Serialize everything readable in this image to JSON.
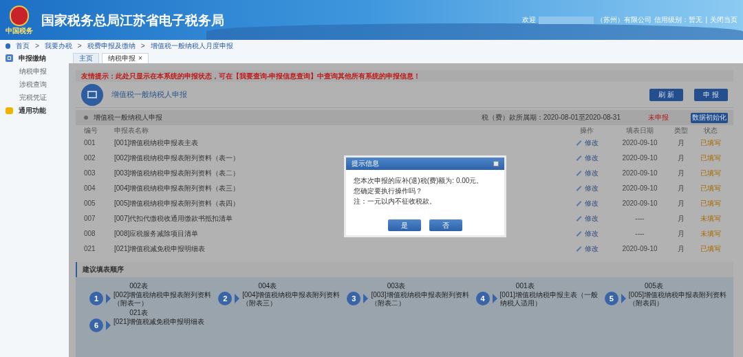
{
  "header": {
    "title": "国家税务总局江苏省电子税务局",
    "logo_text": "中国税务",
    "welcome": "欢迎",
    "company": "（苏州）有限公司",
    "credit": "信用级别：暂无",
    "separator": "|",
    "close": "关闭当页"
  },
  "breadcrumb": [
    "首页",
    "我要办税",
    "税费申报及缴纳",
    "增值税一般纳税人月度申报"
  ],
  "breadcrumb_separator": ">",
  "sidebar": [
    {
      "label": "申报缴纳",
      "children": [
        {
          "label": "纳税申报"
        },
        {
          "label": "涉税查询"
        },
        {
          "label": "完税凭证"
        }
      ]
    },
    {
      "label": "通用功能"
    }
  ],
  "tabs": [
    {
      "label": "主页",
      "selected": false,
      "closable": false
    },
    {
      "label": "纳税申报",
      "selected": true,
      "closable": true
    }
  ],
  "tab_close": "×",
  "notice": "友情提示：此处只显示在本系统的申报状态，可在【我要查询-申报信息查询】中查询其他所有系统的申报信息！",
  "form_title": "增值税一般纳税人申报",
  "buttons": [
    "刷 新",
    "申 报"
  ],
  "section": {
    "label": "增值税一般纳税人申报",
    "period": "税（费）款所属期：2020-08-01至2020-08-31",
    "status": "未申报",
    "init_button": "数据初始化"
  },
  "table": {
    "columns": [
      "编号",
      "申报表名称",
      "操作",
      "填表日期",
      "类型",
      "状态"
    ],
    "rows": [
      {
        "no": "001",
        "name": "[001]增值税纳税申报表主表",
        "action": "修改",
        "date": "2020-09-10",
        "type": "月",
        "status": "已填写"
      },
      {
        "no": "002",
        "name": "[002]增值税纳税申报表附列资料（表一）",
        "action": "修改",
        "date": "2020-09-10",
        "type": "月",
        "status": "已填写"
      },
      {
        "no": "003",
        "name": "[003]增值税纳税申报表附列资料（表二）",
        "action": "修改",
        "date": "2020-09-10",
        "type": "月",
        "status": "已填写"
      },
      {
        "no": "004",
        "name": "[004]增值税纳税申报表附列资料（表三）",
        "action": "修改",
        "date": "2020-09-10",
        "type": "月",
        "status": "已填写"
      },
      {
        "no": "005",
        "name": "[005]增值税纳税申报表附列资料（表四）",
        "action": "修改",
        "date": "2020-09-10",
        "type": "月",
        "status": "已填写"
      },
      {
        "no": "007",
        "name": "[007]代扣代缴税收通用缴款书抵扣清单",
        "action": "修改",
        "date": "----",
        "type": "月",
        "status": "未填写"
      },
      {
        "no": "008",
        "name": "[008]应税服务减除项目清单",
        "action": "修改",
        "date": "----",
        "type": "月",
        "status": "未填写"
      },
      {
        "no": "021",
        "name": "[021]增值税减免税申报明细表",
        "action": "修改",
        "date": "2020-09-10",
        "type": "月",
        "status": "已填写"
      }
    ]
  },
  "order": {
    "title": "建议填表顺序",
    "steps": [
      {
        "number": "1",
        "code": "002表",
        "desc": [
          "[002]增值税纳税申报表附列资料",
          "（附表一）"
        ]
      },
      {
        "number": "2",
        "code": "004表",
        "desc": [
          "[004]增值税纳税申报表附列资料",
          "（附表三）"
        ]
      },
      {
        "number": "3",
        "code": "003表",
        "desc": [
          "[003]增值税纳税申报表附列资料",
          "（附表二）"
        ]
      },
      {
        "number": "4",
        "code": "001表",
        "desc": [
          "[001]增值税纳税申报主表（一般",
          "纳税人适用）"
        ]
      },
      {
        "number": "5",
        "code": "005表",
        "desc": [
          "[005]增值税纳税申报表附列资料",
          "（附表四）"
        ]
      },
      {
        "number": "6",
        "code": "021表",
        "desc": [
          "[021]增值税减免税申报明细表"
        ]
      }
    ]
  },
  "dialog": {
    "title": "提示信息",
    "lines": [
      "您本次申报的应补(退)税(费)额为: 0.00元。",
      "您确定要执行操作吗？",
      "注：一元以内不征收税款。"
    ],
    "buttons": [
      "是",
      "否"
    ]
  }
}
